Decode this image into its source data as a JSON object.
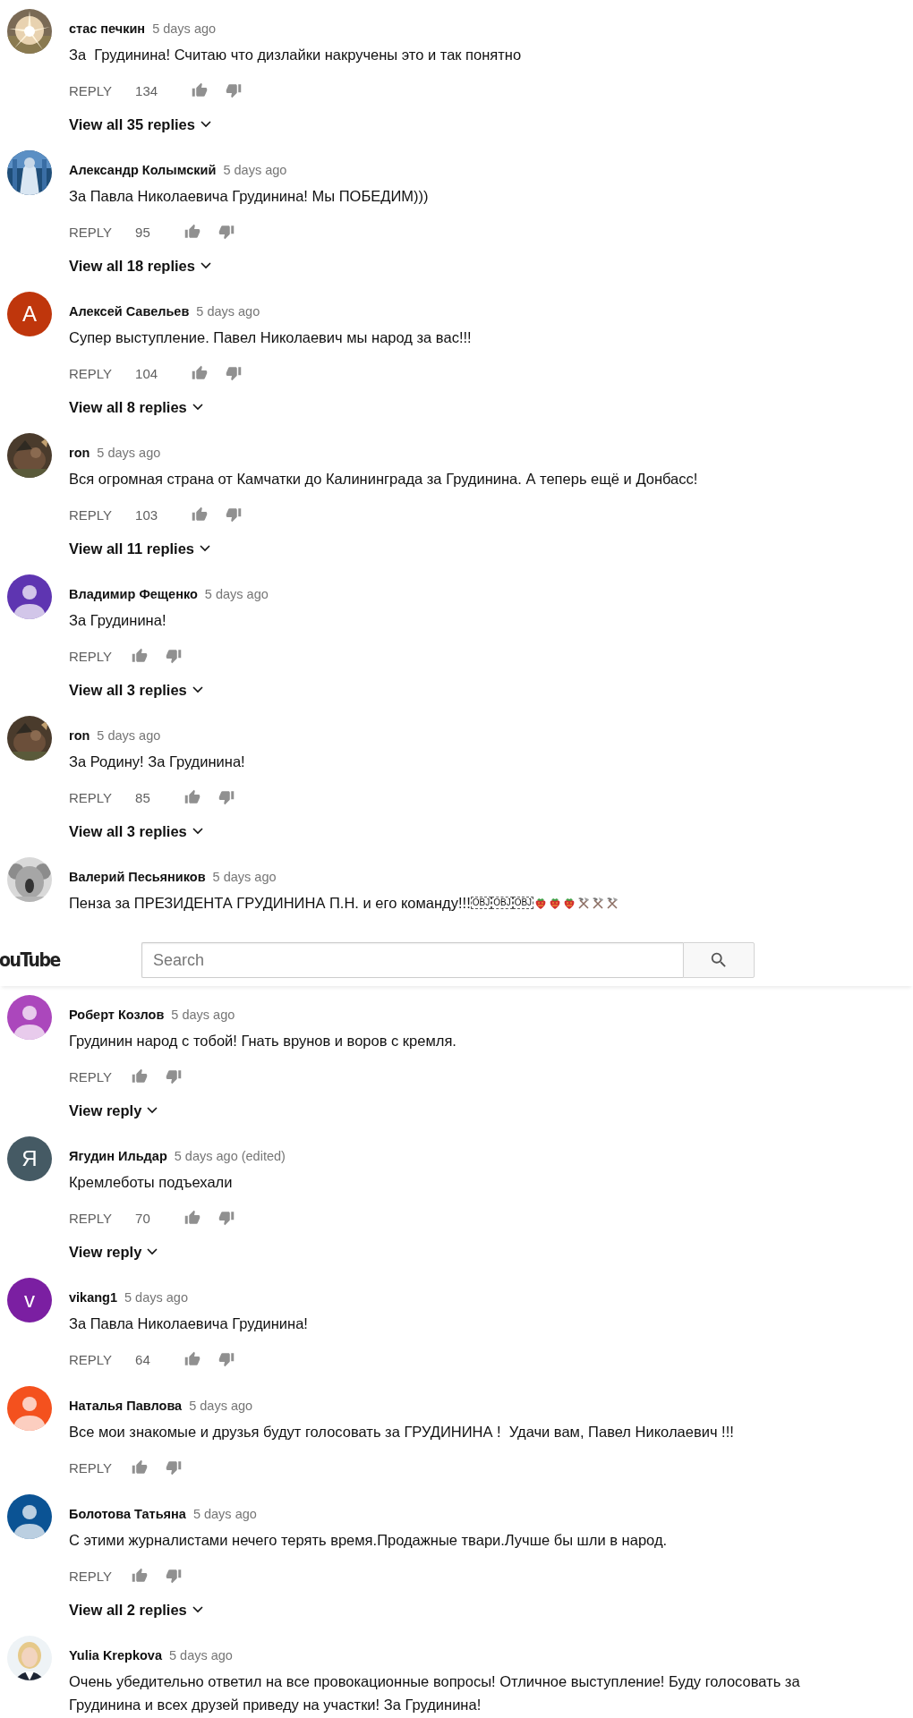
{
  "comments_before_header": [
    {
      "author": "стас печкин",
      "time": "5 days ago",
      "text": "За  Грудинина! Считаю что дизлайки накручены это и так понятно",
      "avatar": {
        "kind": "picture"
      },
      "reply_label": "REPLY",
      "likes": "134",
      "replies_link": "View all 35 replies"
    },
    {
      "author": "Александр Колымский",
      "time": "5 days ago",
      "text": "За Павла Николаевича Грудинина! Мы ПОБЕДИМ)))",
      "avatar": {
        "kind": "picture"
      },
      "reply_label": "REPLY",
      "likes": "95",
      "replies_link": "View all 18 replies"
    },
    {
      "author": "Алексей Савельев",
      "time": "5 days ago",
      "text": "Супер выступление. Павел Николаевич мы народ за вас!!!",
      "avatar": {
        "kind": "letter",
        "letter": "А",
        "color": "#bf360c"
      },
      "reply_label": "REPLY",
      "likes": "104",
      "replies_link": "View all 8 replies"
    },
    {
      "author": "ron",
      "time": "5 days ago",
      "text": "Вся огромная страна от Камчатки до Калининграда за Грудинина. А теперь ещё и Донбасс!",
      "avatar": {
        "kind": "picture"
      },
      "reply_label": "REPLY",
      "likes": "103",
      "replies_link": "View all 11 replies"
    },
    {
      "author": "Владимир Фещенко",
      "time": "5 days ago",
      "text": "За Грудинина!",
      "avatar": {
        "kind": "silhouette",
        "color": "#5e35b1"
      },
      "reply_label": "REPLY",
      "replies_link": "View all 3 replies"
    },
    {
      "author": "ron",
      "time": "5 days ago",
      "text": "За Родину! За Грудинина!",
      "avatar": {
        "kind": "picture"
      },
      "reply_label": "REPLY",
      "likes": "85",
      "replies_link": "View all 3 replies"
    },
    {
      "author": "Валерий Песьяников",
      "time": "5 days ago",
      "text": "Пенза за ПРЕЗИДЕНТА ГРУДИНИНА П.Н. и его команду!!!",
      "objects": [
        "OBJ",
        "OBJ",
        "OBJ"
      ],
      "trailing_icons": [
        {
          "kind": "strawberry"
        },
        {
          "kind": "strawberry"
        },
        {
          "kind": "strawberry"
        },
        {
          "kind": "tools"
        },
        {
          "kind": "tools"
        },
        {
          "kind": "tools"
        }
      ],
      "avatar": {
        "kind": "picture"
      }
    }
  ],
  "header": {
    "logo": "ouTube",
    "search": {
      "placeholder": "Search"
    }
  },
  "comments_after_header": [
    {
      "author": "Роберт Козлов",
      "time": "5 days ago",
      "text": "Грудинин народ с тобой! Гнать врунов и воров с кремля.",
      "avatar": {
        "kind": "silhouette",
        "color": "#ab47bc"
      },
      "reply_label": "REPLY",
      "replies_link": "View reply"
    },
    {
      "author": "Ягудин Ильдар",
      "time": "5 days ago (edited)",
      "text": "Кремлеботы подъехали",
      "avatar": {
        "kind": "letter",
        "letter": "Я",
        "color": "#455a64"
      },
      "reply_label": "REPLY",
      "likes": "70",
      "replies_link": "View reply"
    },
    {
      "author": "vikang1",
      "time": "5 days ago",
      "text": "За Павла Николаевича Грудинина!",
      "avatar": {
        "kind": "letter",
        "letter": "v",
        "color": "#7b1fa2"
      },
      "reply_label": "REPLY",
      "likes": "64"
    },
    {
      "author": "Наталья Павлова",
      "time": "5 days ago",
      "text": "Все мои знакомые и друзья будут голосовать за ГРУДИНИНА !  Удачи вам, Павел Николаевич !!!",
      "avatar": {
        "kind": "silhouette",
        "color": "#f4511e"
      },
      "reply_label": "REPLY"
    },
    {
      "author": "Болотова Татьяна",
      "time": "5 days ago",
      "text": "С этими журналистами нечего терять время.Продажные твари.Лучше бы шли в народ.",
      "avatar": {
        "kind": "silhouette",
        "color": "#0b5394"
      },
      "reply_label": "REPLY",
      "replies_link": "View all 2 replies"
    },
    {
      "author": "Yulia Krepkova",
      "time": "5 days ago",
      "text": "Очень убедительно ответил на все провокационные вопросы! Отличное выступление! Буду голосовать за Грудинина и всех друзей приведу на участки! За Грудинина!",
      "avatar": {
        "kind": "picture"
      }
    }
  ]
}
